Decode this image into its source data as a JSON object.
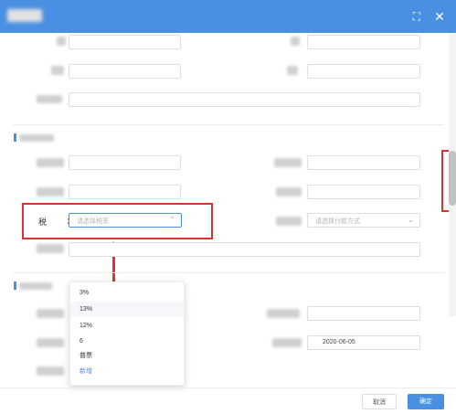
{
  "header": {
    "expand_icon": "fullscreen-icon",
    "close_icon": "close-icon",
    "expand_glyph": "⛶",
    "close_glyph": "✕",
    "color": "#4a90e2"
  },
  "tax_rate": {
    "label": "税  率",
    "placeholder": "请选择税率",
    "caret": "⌃"
  },
  "payment": {
    "placeholder": "请选择付款方式",
    "caret": "⌄"
  },
  "date_field": {
    "value": "2020-06-05"
  },
  "dropdown": {
    "items": [
      "3%",
      "13%",
      "12%",
      "6",
      "普票"
    ],
    "add_label": "新增"
  },
  "footer": {
    "cancel_label": "取消",
    "ok_label": "确定"
  },
  "colors": {
    "accent": "#4a90e2",
    "highlight": "#e03030"
  }
}
